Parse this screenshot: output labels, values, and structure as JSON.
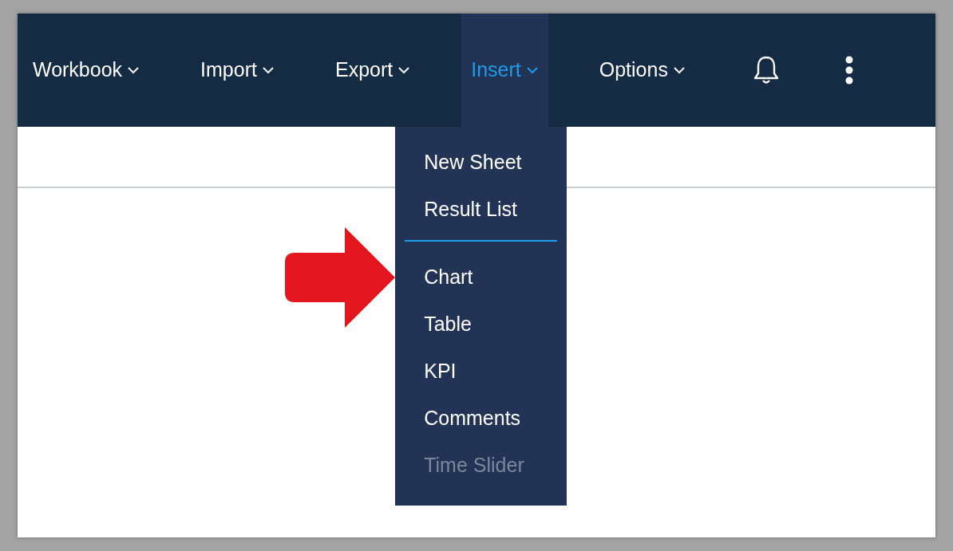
{
  "menu_bar": [
    {
      "label": "Workbook",
      "selected": false
    },
    {
      "label": "Import",
      "selected": false
    },
    {
      "label": "Export",
      "selected": false
    },
    {
      "label": "Insert",
      "selected": true
    },
    {
      "label": "Options",
      "selected": false
    }
  ],
  "dropdown": [
    {
      "kind": "item",
      "label": "New Sheet",
      "disabled": false
    },
    {
      "kind": "item",
      "label": "Result List",
      "disabled": false
    },
    {
      "kind": "divider"
    },
    {
      "kind": "item",
      "label": "Chart",
      "disabled": false
    },
    {
      "kind": "item",
      "label": "Table",
      "disabled": false
    },
    {
      "kind": "item",
      "label": "KPI",
      "disabled": false
    },
    {
      "kind": "item",
      "label": "Comments",
      "disabled": false
    },
    {
      "kind": "item",
      "label": "Time Slider",
      "disabled": true
    }
  ]
}
